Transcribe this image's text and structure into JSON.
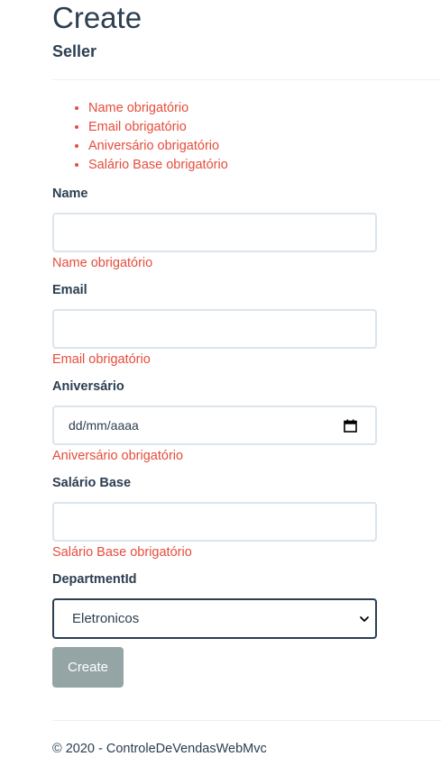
{
  "header": {
    "title": "Create",
    "subtitle": "Seller"
  },
  "validation_summary": [
    "Name obrigatório",
    "Email obrigatório",
    "Aniversário obrigatório",
    "Salário Base obrigatório"
  ],
  "form": {
    "name": {
      "label": "Name",
      "value": "",
      "error": "Name obrigatório"
    },
    "email": {
      "label": "Email",
      "value": "",
      "error": "Email obrigatório"
    },
    "birthday": {
      "label": "Aniversário",
      "placeholder": "dd/mm/aaaa",
      "error": "Aniversário obrigatório",
      "icon": "calendar-icon"
    },
    "base_salary": {
      "label": "Salário Base",
      "value": "",
      "error": "Salário Base obrigatório"
    },
    "department": {
      "label": "DepartmentId",
      "selected": "Eletronicos",
      "icon": "chevron-down-icon"
    },
    "submit_label": "Create"
  },
  "footer": {
    "text": "© 2020 - ControleDeVendasWebMvc"
  },
  "colors": {
    "text": "#2c3e50",
    "error": "#e74c3c",
    "button_bg": "#95a5a6",
    "input_border": "#dce4ec",
    "select_border": "#2c3e50"
  }
}
